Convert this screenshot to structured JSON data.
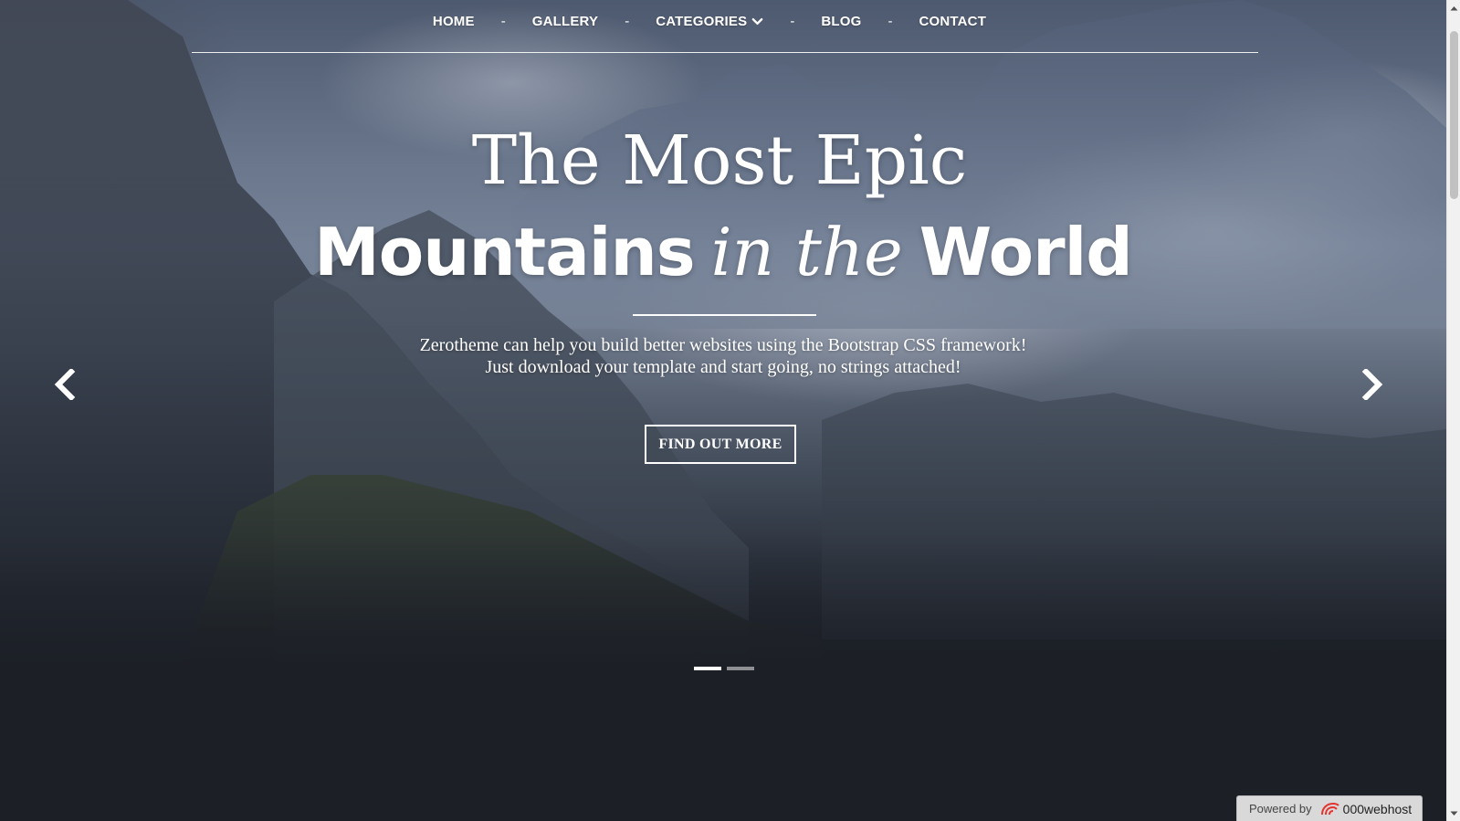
{
  "nav": {
    "items": [
      {
        "label": "HOME"
      },
      {
        "label": "GALLERY"
      },
      {
        "label": "CATEGORIES",
        "has_dropdown": true
      },
      {
        "label": "BLOG"
      },
      {
        "label": "CONTACT"
      }
    ],
    "separator": "-"
  },
  "hero": {
    "title_line1": "The Most Epic",
    "title_line2_a": "Mountains",
    "title_line2_b": "in the",
    "title_line2_c": "World",
    "subtitle_line1": "Zerotheme can help you build better websites using the Bootstrap CSS framework!",
    "subtitle_line2": "Just download your template and start going, no strings attached!",
    "cta_label": "FIND OUT MORE"
  },
  "carousel": {
    "slide_count": 2,
    "active_index": 0,
    "prev_icon": "chevron-left-icon",
    "next_icon": "chevron-right-icon"
  },
  "badge": {
    "prefix": "Powered by",
    "brand": "000webhost",
    "logo_icon": "000webhost-logo-icon",
    "logo_color": "#e3342f"
  },
  "colors": {
    "text": "#ffffff",
    "page_bottom": "#1c1f26"
  }
}
